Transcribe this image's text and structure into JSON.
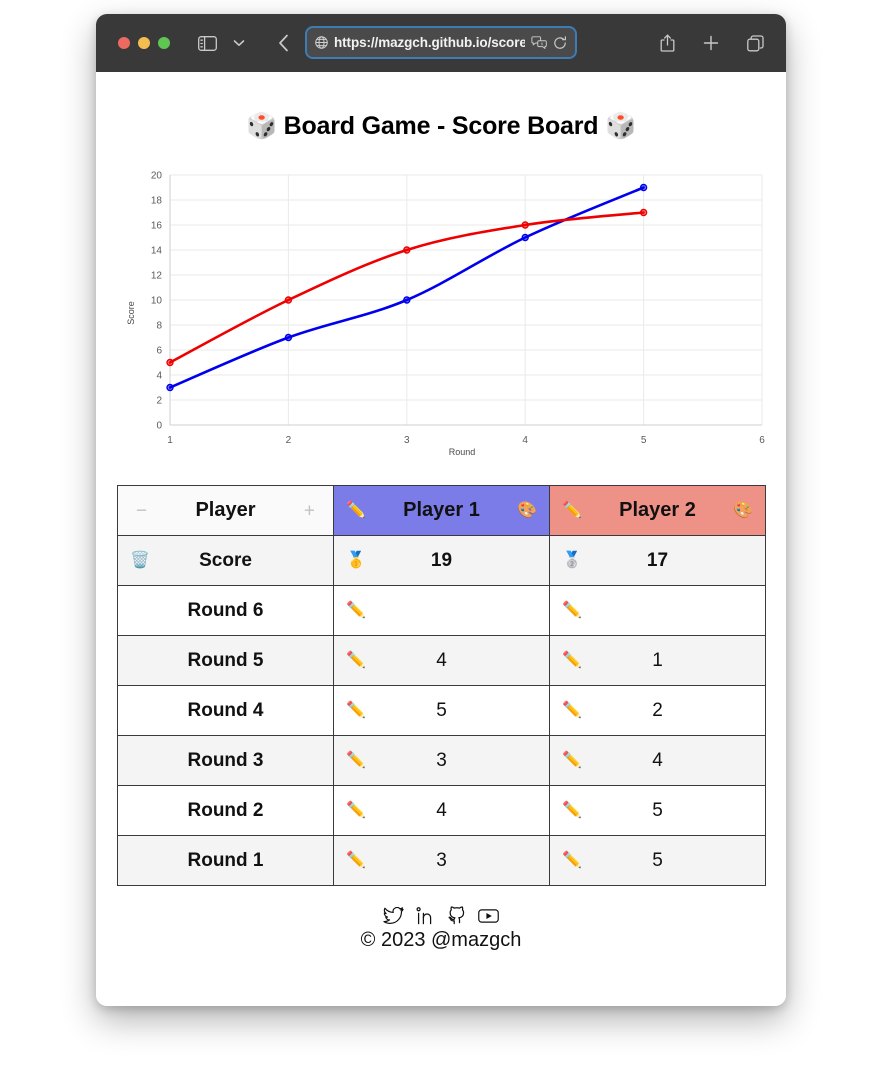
{
  "browser": {
    "url": "https://mazgch.github.io/score/",
    "controls": {
      "close": "close-window",
      "minimize": "minimize-window",
      "maximize": "maximize-window",
      "sidebar": "sidebar-toggle",
      "tab_menu": "tab-overview-chevron",
      "back": "back",
      "forward": "forward",
      "privacy": "privacy-shield",
      "globe": "site-globe",
      "translate": "translate-page",
      "reload": "reload-page",
      "share": "share",
      "new_tab": "new-tab",
      "tabs": "show-all-tabs"
    }
  },
  "page": {
    "title": "🎲 Board Game - Score Board 🎲"
  },
  "chart_data": {
    "type": "line",
    "title": "",
    "xlabel": "Round",
    "ylabel": "Score",
    "x": [
      1,
      2,
      3,
      4,
      5
    ],
    "xlim": [
      1,
      6
    ],
    "ylim": [
      0,
      20
    ],
    "xticks": [
      1,
      2,
      3,
      4,
      5,
      6
    ],
    "yticks": [
      0,
      2,
      4,
      6,
      8,
      10,
      12,
      14,
      16,
      18,
      20
    ],
    "grid": true,
    "legend": "none",
    "series": [
      {
        "name": "Player 1",
        "color": "#0000ee",
        "values": [
          3,
          7,
          10,
          15,
          19
        ]
      },
      {
        "name": "Player 2",
        "color": "#ee0000",
        "values": [
          5,
          10,
          14,
          16,
          17
        ]
      }
    ]
  },
  "table": {
    "header": {
      "remove_icon": "−",
      "label": "Player",
      "add_icon": "+",
      "players": [
        {
          "name": "Player 1",
          "color": "#7b7ce8",
          "edit_icon": "✏️",
          "palette_icon": "🎨"
        },
        {
          "name": "Player 2",
          "color": "#ee9288",
          "edit_icon": "✏️",
          "palette_icon": "🎨"
        }
      ]
    },
    "score_row": {
      "icon": "🗑️",
      "label": "Score",
      "values": [
        {
          "medal": "🥇",
          "value": "19"
        },
        {
          "medal": "🥈",
          "value": "17"
        }
      ]
    },
    "rounds": [
      {
        "label": "Round 6",
        "cells": [
          {
            "icon": "✏️",
            "value": ""
          },
          {
            "icon": "✏️",
            "value": ""
          }
        ]
      },
      {
        "label": "Round 5",
        "cells": [
          {
            "icon": "✏️",
            "value": "4"
          },
          {
            "icon": "✏️",
            "value": "1"
          }
        ]
      },
      {
        "label": "Round 4",
        "cells": [
          {
            "icon": "✏️",
            "value": "5"
          },
          {
            "icon": "✏️",
            "value": "2"
          }
        ]
      },
      {
        "label": "Round 3",
        "cells": [
          {
            "icon": "✏️",
            "value": "3"
          },
          {
            "icon": "✏️",
            "value": "4"
          }
        ]
      },
      {
        "label": "Round 2",
        "cells": [
          {
            "icon": "✏️",
            "value": "4"
          },
          {
            "icon": "✏️",
            "value": "5"
          }
        ]
      },
      {
        "label": "Round 1",
        "cells": [
          {
            "icon": "✏️",
            "value": "3"
          },
          {
            "icon": "✏️",
            "value": "5"
          }
        ]
      }
    ]
  },
  "footer": {
    "social": [
      "twitter-icon",
      "linkedin-icon",
      "github-icon",
      "youtube-icon"
    ],
    "copyright": "© 2023 @mazgch"
  }
}
